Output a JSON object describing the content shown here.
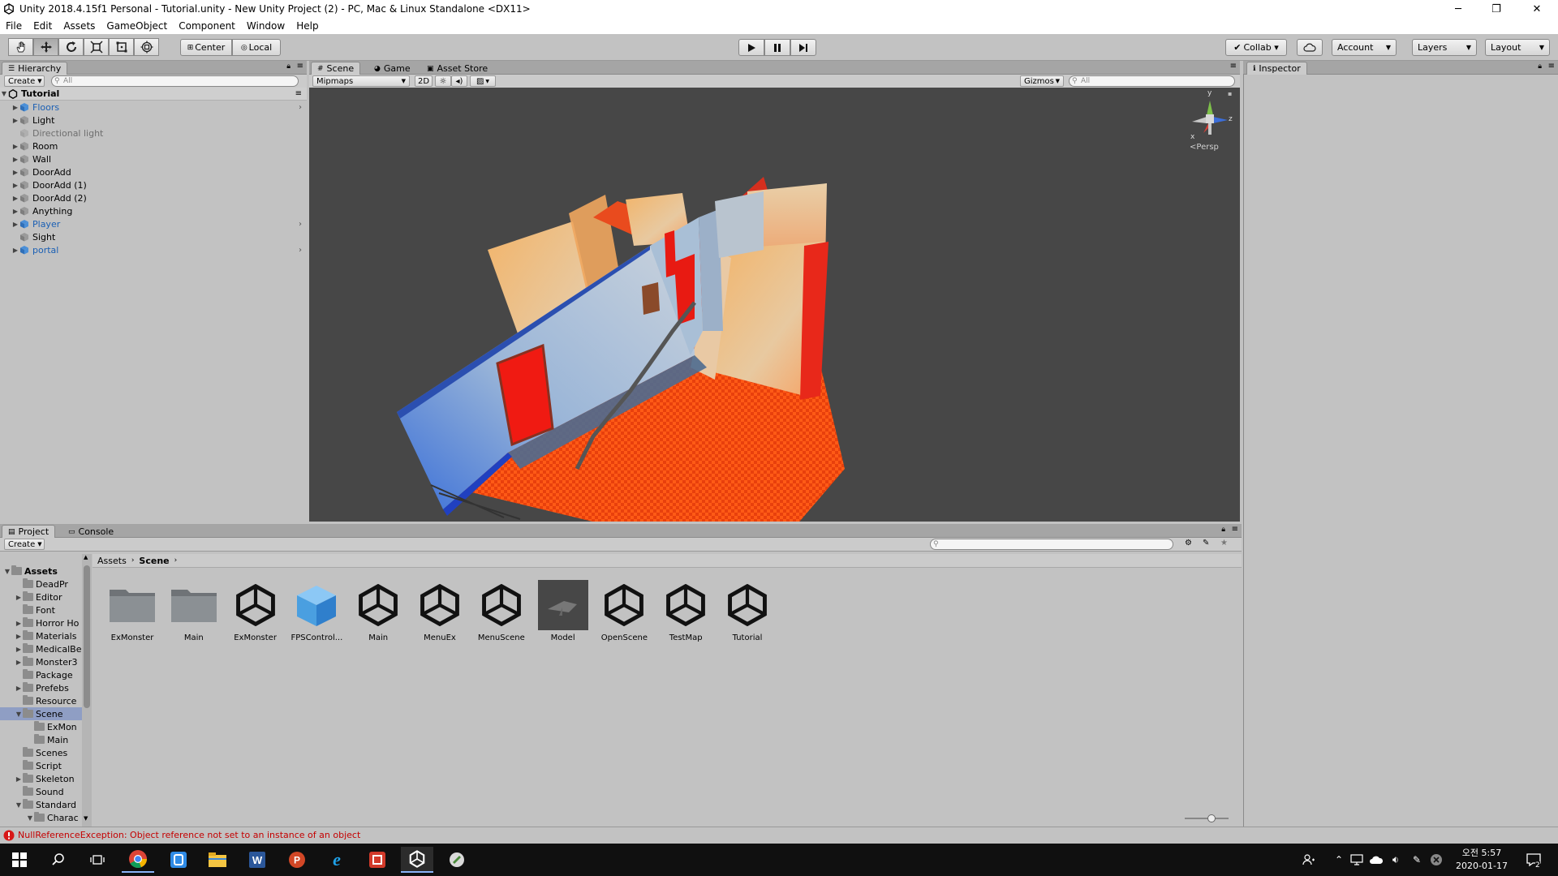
{
  "window": {
    "title": "Unity 2018.4.15f1 Personal - Tutorial.unity - New Unity Project (2) - PC, Mac & Linux Standalone <DX11>",
    "minimize": "─",
    "restore": "❐",
    "close": "✕"
  },
  "menu": [
    "File",
    "Edit",
    "Assets",
    "GameObject",
    "Component",
    "Window",
    "Help"
  ],
  "toolbar": {
    "tools": [
      "hand-tool",
      "move-tool",
      "rotate-tool",
      "scale-tool",
      "rect-tool",
      "transform-tool"
    ],
    "pivot": "Center",
    "space": "Local",
    "collab": "Collab ▾",
    "account": "Account",
    "layers": "Layers",
    "layout": "Layout"
  },
  "hierarchy": {
    "tab": "Hierarchy",
    "create": "Create",
    "search_placeholder": "All",
    "scene_name": "Tutorial",
    "items": [
      {
        "name": "Floors",
        "expandable": true,
        "prefab": true,
        "disabled": false
      },
      {
        "name": "Light",
        "expandable": true,
        "prefab": false,
        "disabled": false
      },
      {
        "name": "Directional light",
        "expandable": false,
        "prefab": false,
        "disabled": true
      },
      {
        "name": "Room",
        "expandable": true,
        "prefab": false,
        "disabled": false
      },
      {
        "name": "Wall",
        "expandable": true,
        "prefab": false,
        "disabled": false
      },
      {
        "name": "DoorAdd",
        "expandable": true,
        "prefab": false,
        "disabled": false
      },
      {
        "name": "DoorAdd (1)",
        "expandable": true,
        "prefab": false,
        "disabled": false
      },
      {
        "name": "DoorAdd (2)",
        "expandable": true,
        "prefab": false,
        "disabled": false
      },
      {
        "name": "Anything",
        "expandable": true,
        "prefab": false,
        "disabled": false
      },
      {
        "name": "Player",
        "expandable": true,
        "prefab": true,
        "disabled": false
      },
      {
        "name": "Sight",
        "expandable": false,
        "prefab": false,
        "disabled": false
      },
      {
        "name": "portal",
        "expandable": true,
        "prefab": true,
        "disabled": false
      }
    ]
  },
  "scene_view": {
    "tabs": [
      "Scene",
      "Game",
      "Asset Store"
    ],
    "mipmaps": "Mipmaps",
    "mode_2d": "2D",
    "gizmos": "Gizmos",
    "search_placeholder": "All",
    "gizmo_axes": {
      "y": "y",
      "z": "z",
      "x": "x"
    },
    "projection": "Persp"
  },
  "inspector": {
    "tab": "Inspector"
  },
  "project": {
    "tabs": [
      "Project",
      "Console"
    ],
    "create": "Create",
    "breadcrumb": [
      "Assets",
      "Scene"
    ],
    "tree": [
      {
        "name": "Assets",
        "depth": 0,
        "arrow": "open",
        "bold": true
      },
      {
        "name": "DeadPr",
        "depth": 1,
        "arrow": "none"
      },
      {
        "name": "Editor",
        "depth": 1,
        "arrow": "closed"
      },
      {
        "name": "Font",
        "depth": 1,
        "arrow": "none"
      },
      {
        "name": "Horror Ho",
        "depth": 1,
        "arrow": "closed"
      },
      {
        "name": "Materials",
        "depth": 1,
        "arrow": "closed"
      },
      {
        "name": "MedicalBe",
        "depth": 1,
        "arrow": "closed"
      },
      {
        "name": "Monster3",
        "depth": 1,
        "arrow": "closed"
      },
      {
        "name": "Package",
        "depth": 1,
        "arrow": "none"
      },
      {
        "name": "Prefebs",
        "depth": 1,
        "arrow": "closed"
      },
      {
        "name": "Resource",
        "depth": 1,
        "arrow": "none"
      },
      {
        "name": "Scene",
        "depth": 1,
        "arrow": "open",
        "selected": true
      },
      {
        "name": "ExMon",
        "depth": 2,
        "arrow": "none"
      },
      {
        "name": "Main",
        "depth": 2,
        "arrow": "none"
      },
      {
        "name": "Scenes",
        "depth": 1,
        "arrow": "none"
      },
      {
        "name": "Script",
        "depth": 1,
        "arrow": "none"
      },
      {
        "name": "Skeleton",
        "depth": 1,
        "arrow": "closed"
      },
      {
        "name": "Sound",
        "depth": 1,
        "arrow": "none"
      },
      {
        "name": "Standard",
        "depth": 1,
        "arrow": "open"
      },
      {
        "name": "Charac",
        "depth": 2,
        "arrow": "open"
      }
    ],
    "assets": [
      {
        "label": "ExMonster",
        "type": "folder"
      },
      {
        "label": "Main",
        "type": "folder"
      },
      {
        "label": "ExMonster",
        "type": "unity"
      },
      {
        "label": "FPSControl...",
        "type": "prefab"
      },
      {
        "label": "Main",
        "type": "unity"
      },
      {
        "label": "MenuEx",
        "type": "unity"
      },
      {
        "label": "MenuScene",
        "type": "unity"
      },
      {
        "label": "Model",
        "type": "model"
      },
      {
        "label": "OpenScene",
        "type": "unity"
      },
      {
        "label": "TestMap",
        "type": "unity"
      },
      {
        "label": "Tutorial",
        "type": "unity"
      }
    ]
  },
  "status": {
    "message": "NullReferenceException: Object reference not set to an instance of an object"
  },
  "taskbar": {
    "clock_time": "오전 5:57",
    "clock_date": "2020-01-17",
    "notification_count": "2"
  },
  "colors": {
    "accent_blue": "#1a5fb4",
    "error_red": "#c40000",
    "selection": "#8f9ec4"
  }
}
